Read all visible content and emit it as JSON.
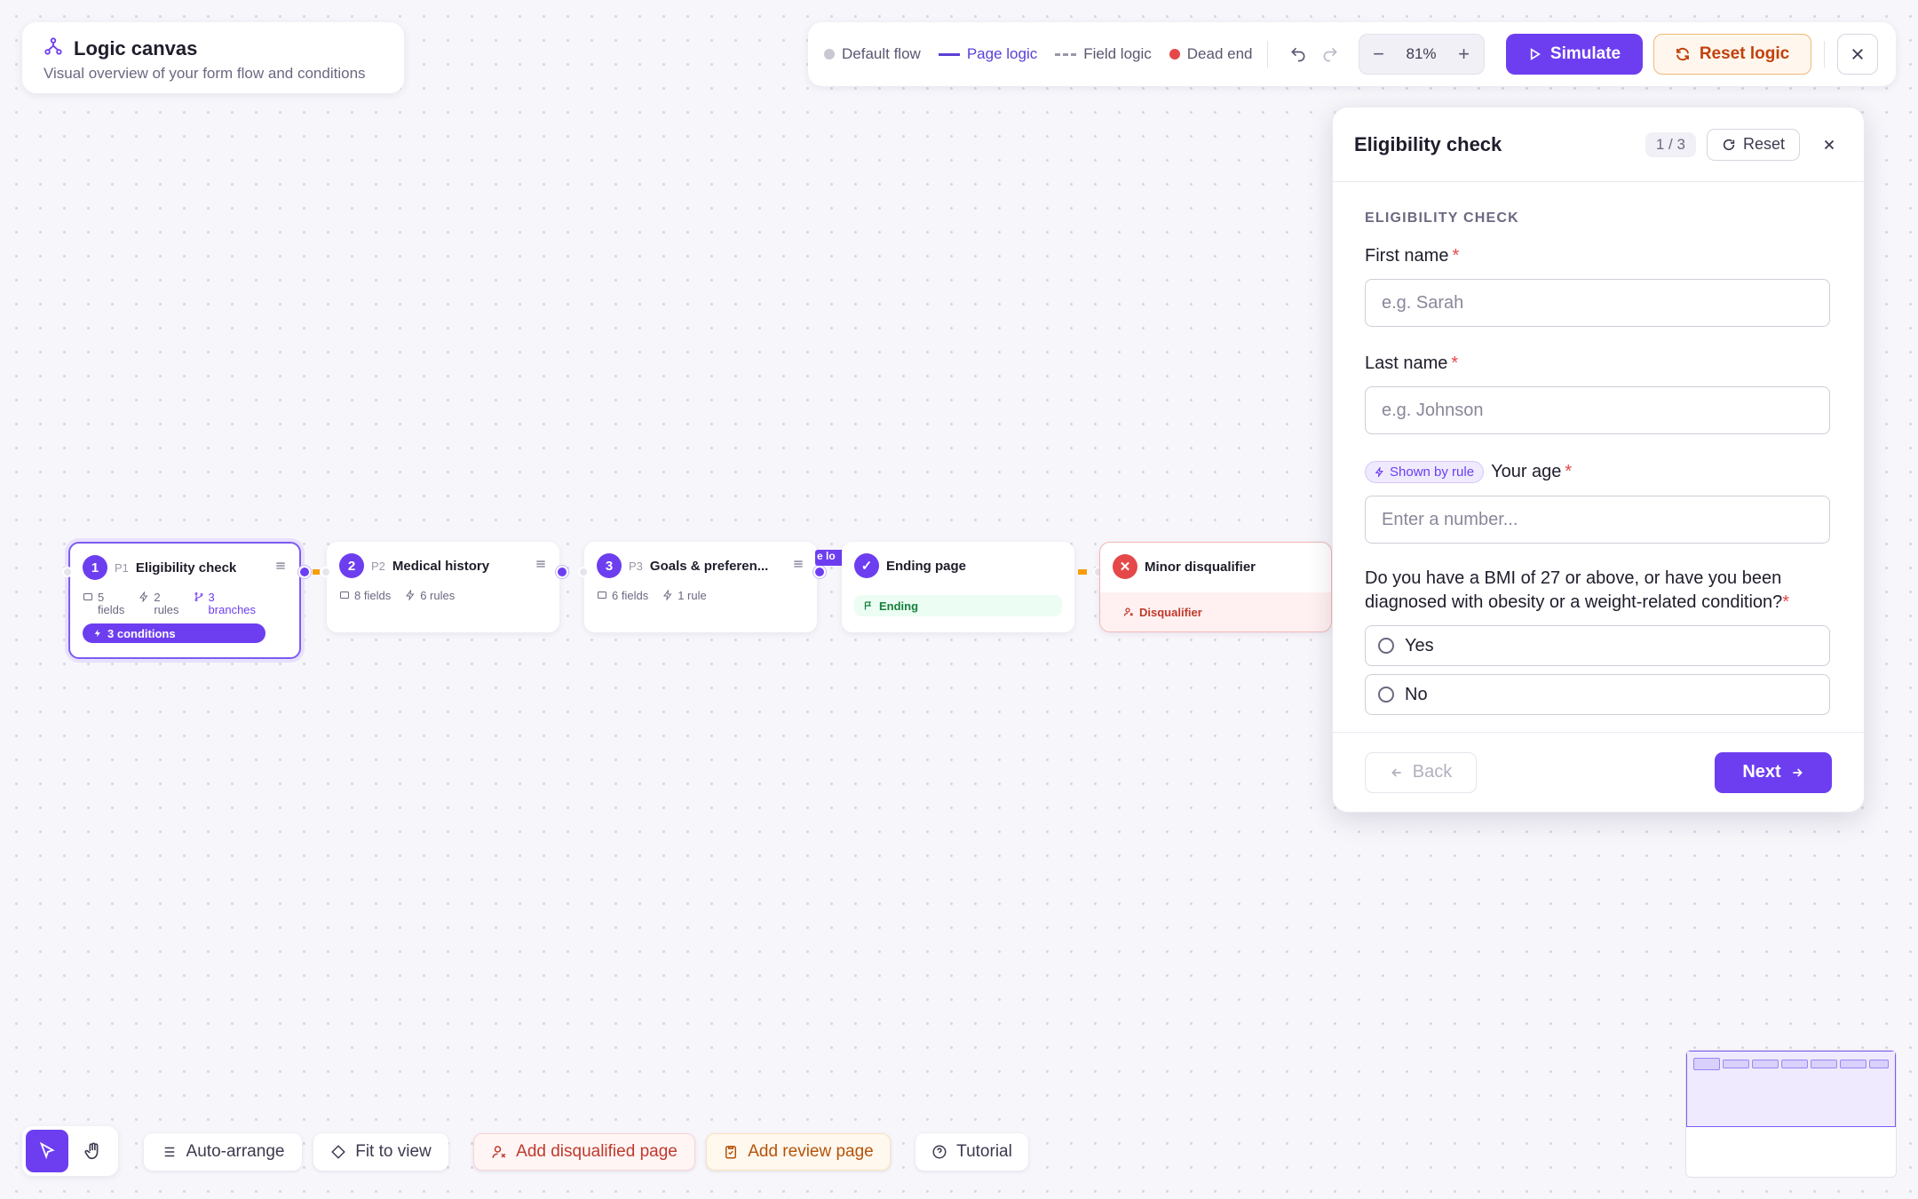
{
  "header": {
    "title": "Logic canvas",
    "subtitle": "Visual overview of your form flow and conditions"
  },
  "legend": {
    "default_flow": "Default flow",
    "page_logic": "Page logic",
    "field_logic": "Field logic",
    "dead_end": "Dead end"
  },
  "colors": {
    "accent": "#6d3ef0",
    "dead_end": "#e54848",
    "default_flow": "#c9c7d3",
    "reset_text": "#c2410c"
  },
  "zoom": {
    "value": "81%"
  },
  "toolbar": {
    "simulate": "Simulate",
    "reset_logic": "Reset logic"
  },
  "nodes": [
    {
      "num": "1",
      "code": "P1",
      "title": "Eligibility check",
      "fields_n": "5",
      "fields_l": "fields",
      "rules_n": "2",
      "rules_l": "rules",
      "branches_n": "3",
      "branches_l": "branches",
      "conditions": "3 conditions"
    },
    {
      "num": "2",
      "code": "P2",
      "title": "Medical history",
      "fields": "8 fields",
      "rules": "6 rules"
    },
    {
      "num": "3",
      "code": "P3",
      "title": "Goals & preferen...",
      "fields": "6 fields",
      "rules": "1 rule"
    },
    {
      "num": "✓",
      "title": "Ending page",
      "tag": "Ending"
    },
    {
      "num": "✕",
      "title": "Minor disqualifier",
      "tag": "Disqualifier"
    }
  ],
  "edge_label": "e lo",
  "panel": {
    "title": "Eligibility check",
    "count": "1 / 3",
    "reset": "Reset",
    "section": "ELIGIBILITY CHECK",
    "first_name": {
      "label": "First name",
      "placeholder": "e.g. Sarah"
    },
    "last_name": {
      "label": "Last name",
      "placeholder": "e.g. Johnson"
    },
    "age": {
      "badge": "Shown by rule",
      "label": "Your age",
      "placeholder": "Enter a number..."
    },
    "bmi": {
      "question": "Do you have a BMI of 27 or above, or have you been diagnosed with obesity or a weight-related condition?",
      "options": [
        "Yes",
        "No"
      ]
    },
    "back": "Back",
    "next": "Next"
  },
  "bottom": {
    "auto_arrange": "Auto-arrange",
    "fit_to_view": "Fit to view",
    "add_disqualified": "Add disqualified page",
    "add_review": "Add review page",
    "tutorial": "Tutorial"
  },
  "required_mark": "*"
}
